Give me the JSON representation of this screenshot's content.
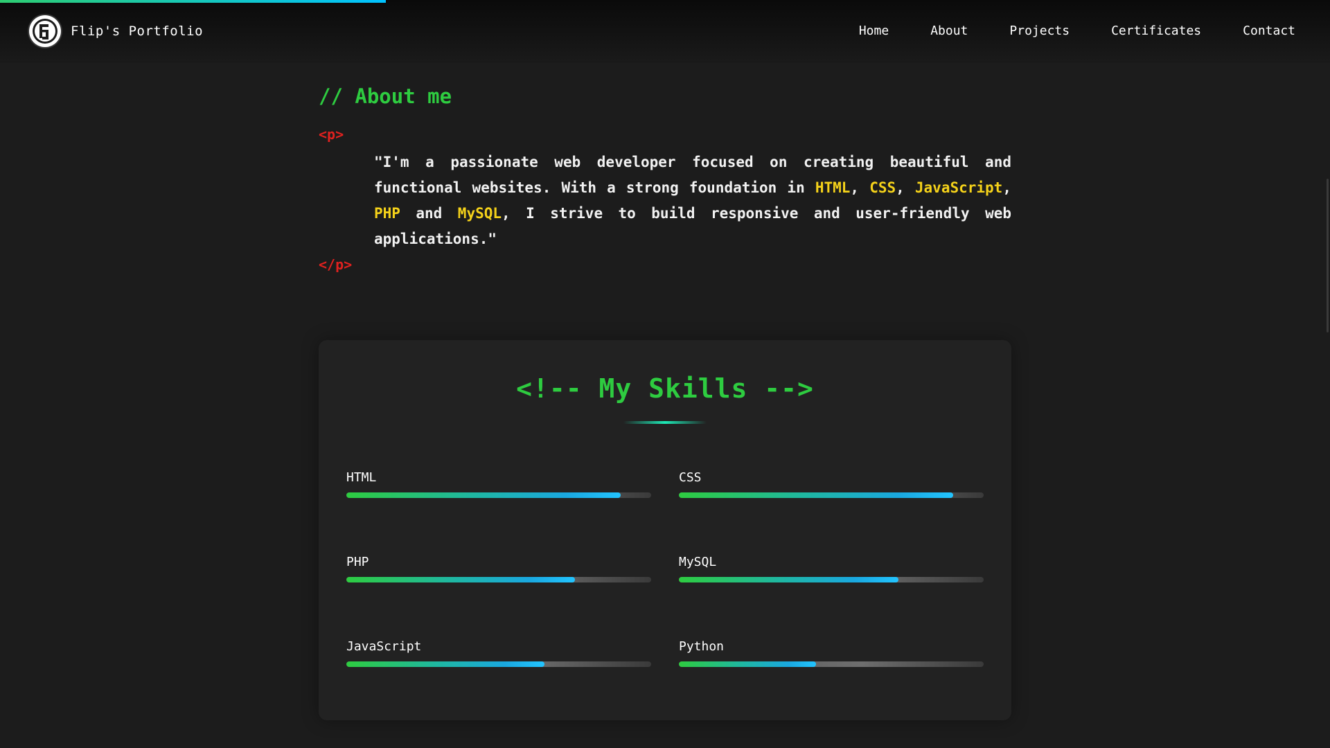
{
  "header": {
    "brand": "Flip's Portfolio",
    "nav": [
      {
        "label": "Home"
      },
      {
        "label": "About"
      },
      {
        "label": "Projects"
      },
      {
        "label": "Certificates"
      },
      {
        "label": "Contact"
      }
    ],
    "scroll_progress": 0.29
  },
  "about": {
    "heading": "// About me",
    "open_tag": "<p>",
    "close_tag": "</p>",
    "text_parts": [
      {
        "text": "\"I'm a passionate web developer focused on creating beautiful and functional websites. With a strong foundation in ",
        "hl": false
      },
      {
        "text": "HTML",
        "hl": true
      },
      {
        "text": ", ",
        "hl": false
      },
      {
        "text": "CSS",
        "hl": true
      },
      {
        "text": ", ",
        "hl": false
      },
      {
        "text": "JavaScript",
        "hl": true
      },
      {
        "text": ", ",
        "hl": false
      },
      {
        "text": "PHP",
        "hl": true
      },
      {
        "text": " and ",
        "hl": false
      },
      {
        "text": "MySQL",
        "hl": true
      },
      {
        "text": ", I strive to build responsive and user-friendly web applications.\"",
        "hl": false
      }
    ]
  },
  "skills": {
    "title": "<!-- My Skills -->",
    "items": [
      {
        "name": "HTML",
        "level": 0.9
      },
      {
        "name": "CSS",
        "level": 0.9
      },
      {
        "name": "PHP",
        "level": 0.75
      },
      {
        "name": "MySQL",
        "level": 0.72
      },
      {
        "name": "JavaScript",
        "level": 0.65
      },
      {
        "name": "Python",
        "level": 0.45
      }
    ]
  },
  "colors": {
    "accent_green": "#2ecc40",
    "highlight_yellow": "#f5d21a",
    "tag_red": "#e0211f",
    "bar_gradient_end": "#22c4ff"
  }
}
